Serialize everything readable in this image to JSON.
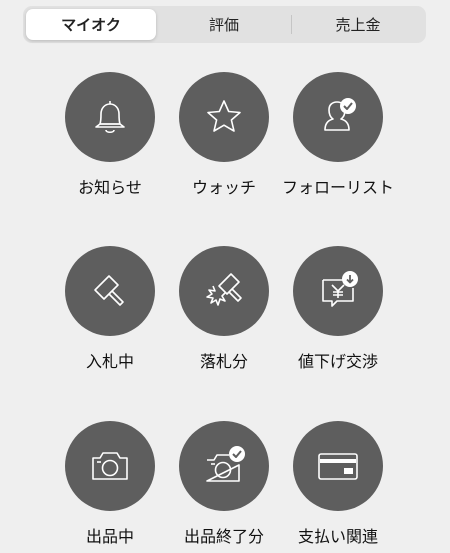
{
  "tabs": [
    {
      "label": "マイオク",
      "active": true
    },
    {
      "label": "評価",
      "active": false
    },
    {
      "label": "売上金",
      "active": false
    }
  ],
  "menu": [
    {
      "label": "お知らせ",
      "icon": "bell-icon"
    },
    {
      "label": "ウォッチ",
      "icon": "star-icon"
    },
    {
      "label": "フォローリスト",
      "icon": "follow-user-icon"
    },
    {
      "label": "入札中",
      "icon": "gavel-icon"
    },
    {
      "label": "落札分",
      "icon": "gavel-won-icon"
    },
    {
      "label": "値下げ交渉",
      "icon": "price-negotiation-icon"
    },
    {
      "label": "出品中",
      "icon": "camera-icon"
    },
    {
      "label": "出品終了分",
      "icon": "camera-check-icon"
    },
    {
      "label": "支払い関連",
      "icon": "credit-card-icon"
    }
  ],
  "colors": {
    "background": "#efefef",
    "circle": "#5e5e5e",
    "icon_stroke": "#ffffff"
  }
}
